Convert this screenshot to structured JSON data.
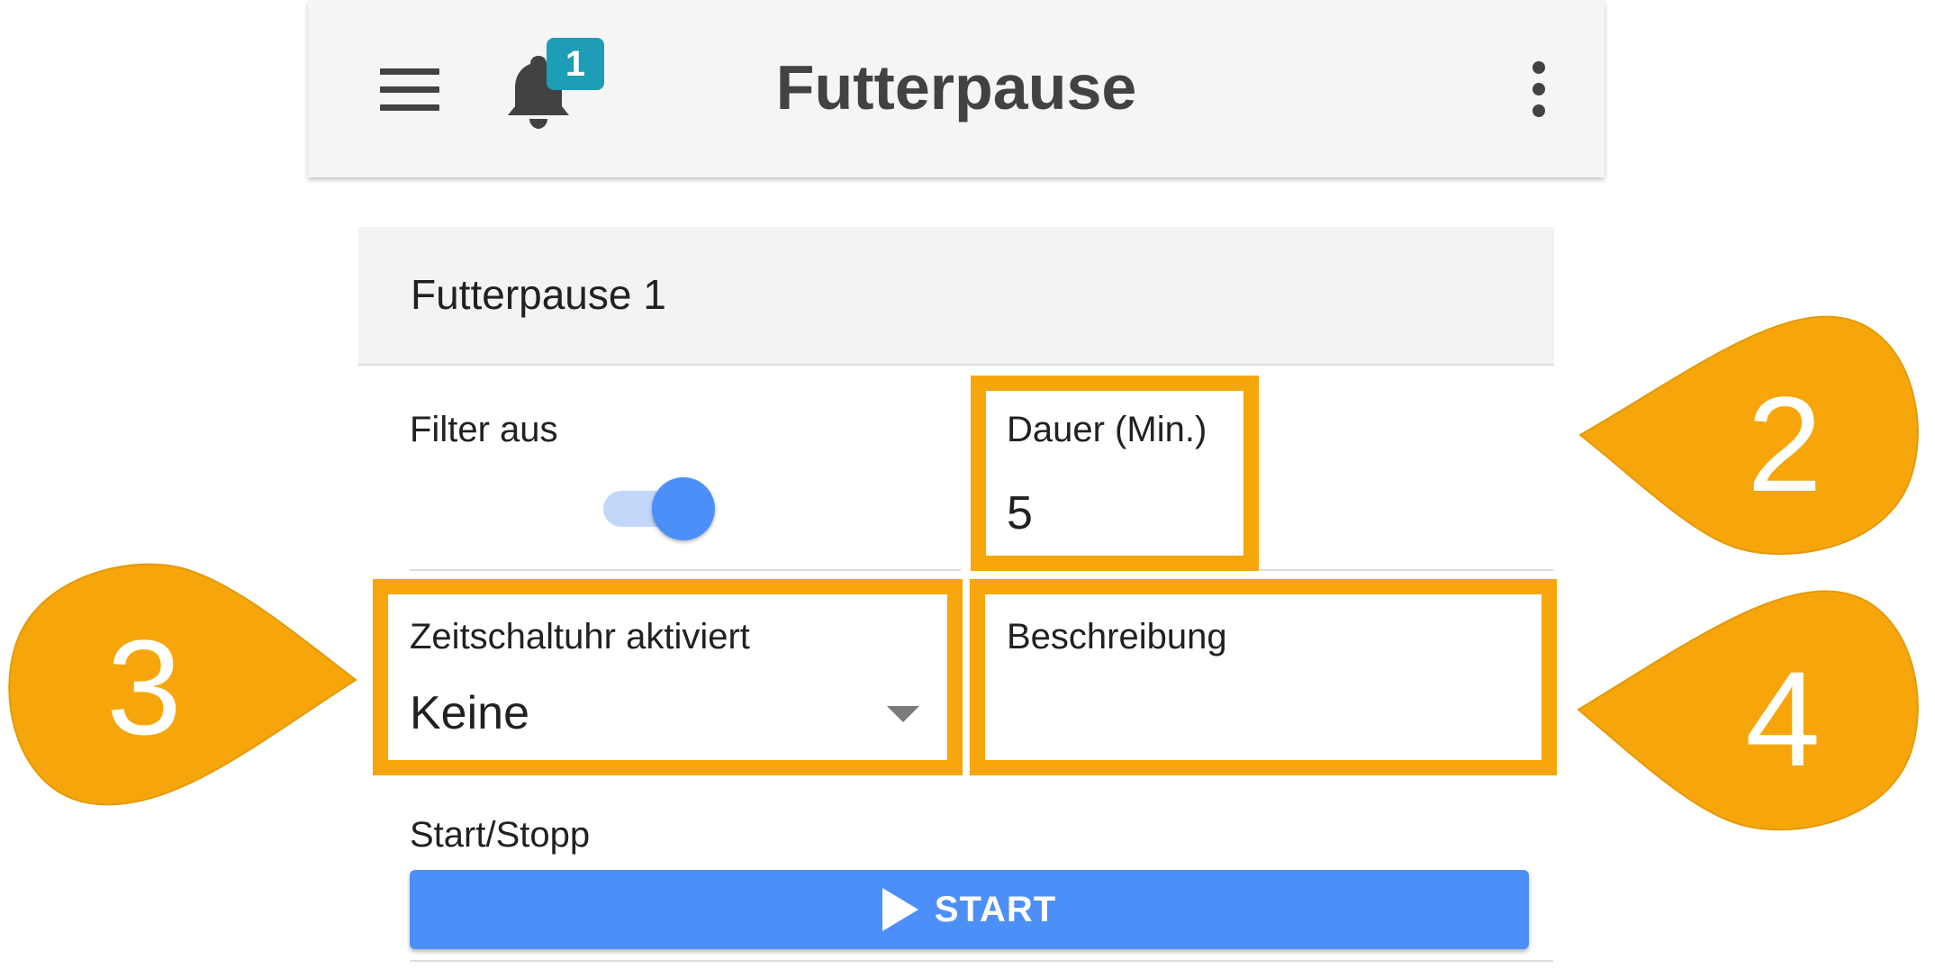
{
  "appbar": {
    "title": "Futterpause",
    "notification_count": "1",
    "icons": {
      "menu": "menu-icon",
      "notifications": "bell-icon",
      "more": "more-vert-icon"
    }
  },
  "card": {
    "title": "Futterpause 1",
    "filter": {
      "label": "Filter aus",
      "toggle_on": true
    },
    "duration": {
      "label": "Dauer (Min.)",
      "value": "5"
    },
    "timer": {
      "label": "Zeitschaltuhr aktiviert",
      "selected": "Keine"
    },
    "description": {
      "label": "Beschreibung",
      "value": ""
    },
    "start_stop": {
      "label": "Start/Stopp",
      "button_label": "START"
    }
  },
  "callouts": [
    "2",
    "3",
    "4"
  ],
  "colors": {
    "accent": "#4d8ff8",
    "badge": "#1e9db7",
    "callout": "#f6a60a",
    "appbar": "#f5f5f5"
  }
}
